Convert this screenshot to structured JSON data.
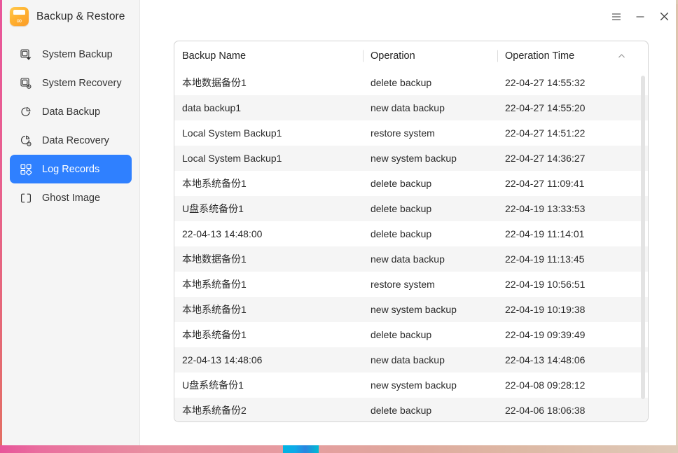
{
  "window": {
    "app_title": "Backup & Restore",
    "app_icon": "backup-restore-app-icon",
    "controls": {
      "menu_label": "☰",
      "menu_icon": "hamburger-menu-icon",
      "minimize_icon": "minimize-icon",
      "close_icon": "close-icon"
    }
  },
  "sidebar": {
    "items": [
      {
        "label": "System Backup",
        "icon": "system-backup-icon",
        "active": false
      },
      {
        "label": "System Recovery",
        "icon": "system-recovery-icon",
        "active": false
      },
      {
        "label": "Data Backup",
        "icon": "data-backup-icon",
        "active": false
      },
      {
        "label": "Data Recovery",
        "icon": "data-recovery-icon",
        "active": false
      },
      {
        "label": "Log Records",
        "icon": "log-records-icon",
        "active": true
      },
      {
        "label": "Ghost Image",
        "icon": "ghost-image-icon",
        "active": false
      }
    ]
  },
  "table": {
    "columns": [
      "Backup Name",
      "Operation",
      "Operation Time"
    ],
    "sort": {
      "column": "Operation Time",
      "direction": "ascending",
      "icon": "chevron-up-icon"
    },
    "rows": [
      {
        "name": "本地数据备份1",
        "operation": "delete backup",
        "time": "22-04-27 14:55:32"
      },
      {
        "name": "data backup1",
        "operation": "new data backup",
        "time": "22-04-27 14:55:20"
      },
      {
        "name": "Local System Backup1",
        "operation": "restore system",
        "time": "22-04-27 14:51:22"
      },
      {
        "name": "Local System Backup1",
        "operation": "new system backup",
        "time": "22-04-27 14:36:27"
      },
      {
        "name": "本地系统备份1",
        "operation": "delete backup",
        "time": "22-04-27 11:09:41"
      },
      {
        "name": "U盘系统备份1",
        "operation": "delete backup",
        "time": "22-04-19 13:33:53"
      },
      {
        "name": "22-04-13 14:48:00",
        "operation": "delete backup",
        "time": "22-04-19 11:14:01"
      },
      {
        "name": "本地数据备份1",
        "operation": "new data backup",
        "time": "22-04-19 11:13:45"
      },
      {
        "name": "本地系统备份1",
        "operation": "restore system",
        "time": "22-04-19 10:56:51"
      },
      {
        "name": "本地系统备份1",
        "operation": "new system backup",
        "time": "22-04-19 10:19:38"
      },
      {
        "name": "本地系统备份1",
        "operation": "delete backup",
        "time": "22-04-19 09:39:49"
      },
      {
        "name": "22-04-13 14:48:06",
        "operation": "new data backup",
        "time": "22-04-13 14:48:06"
      },
      {
        "name": "U盘系统备份1",
        "operation": "new system backup",
        "time": "22-04-08 09:28:12"
      },
      {
        "name": "本地系统备份2",
        "operation": "delete backup",
        "time": "22-04-06 18:06:38"
      }
    ]
  },
  "colors": {
    "accent": "#2f80ff",
    "sidebar_bg": "#f5f5f5",
    "row_alt_bg": "#f5f5f5",
    "table_border": "#d4d4d4",
    "desktop_pink": "#e8559a",
    "desktop_tan": "#e2d0be",
    "taskbar_accent": "#00b5e2",
    "app_icon_orange": "#ffb230"
  }
}
